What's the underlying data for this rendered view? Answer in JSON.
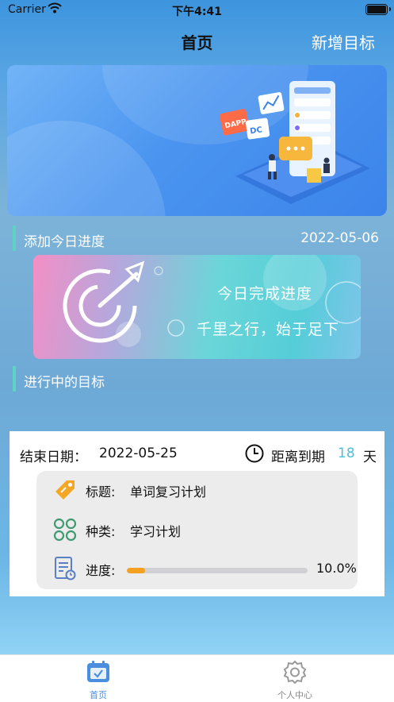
{
  "status_bar": {
    "carrier": "Carrier",
    "time": "下午4:41"
  },
  "nav": {
    "title": "首页",
    "add_goal": "新增目标"
  },
  "banner": {
    "tag_dapp": "DAPP",
    "tag_dc": "DC"
  },
  "today_section": {
    "label": "添加今日进度",
    "date": "2022-05-06"
  },
  "today_card": {
    "line1": "今日完成进度",
    "line2": "千里之行，始于足下"
  },
  "goals_section": {
    "label": "进行中的目标"
  },
  "goal": {
    "end_label": "结束日期：",
    "end_date": "2022-05-25",
    "remain_label": "距离到期",
    "remain_days": "18",
    "remain_unit": "天",
    "title_label": "标题:",
    "title_value": "单词复习计划",
    "kind_label": "种类:",
    "kind_value": "学习计划",
    "progress_label": "进度:",
    "progress_fraction": 0.1,
    "progress_text": "10.0%"
  },
  "tabbar": {
    "home": "首页",
    "profile": "个人中心",
    "active_color": "#4a8ede",
    "inactive_color": "#888888"
  },
  "icons": {
    "tag": "price-tag-icon",
    "kind": "category-grid-icon",
    "progress": "document-clock-icon",
    "clock": "clock-icon"
  }
}
